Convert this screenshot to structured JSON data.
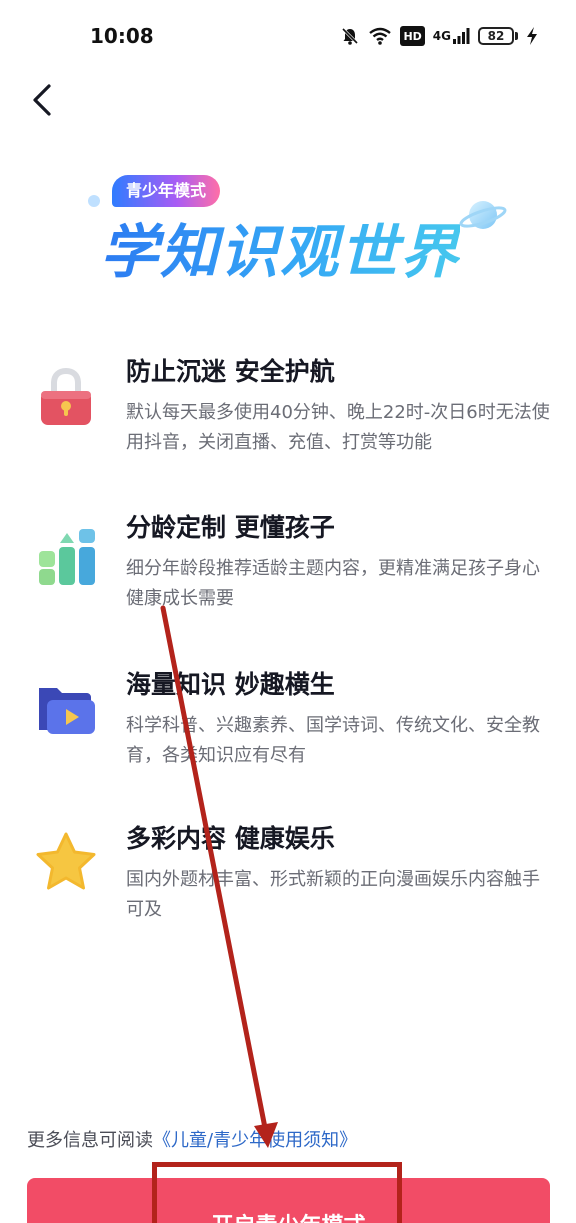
{
  "status_bar": {
    "time": "10:08",
    "hd_label": "HD",
    "network_label": "4G",
    "battery_level": "82"
  },
  "header": {
    "back_icon": "chevron-left-icon"
  },
  "hero": {
    "badge": "青少年模式",
    "title": "学知识观世界"
  },
  "features": [
    {
      "icon": "lock-icon",
      "title": "防止沉迷 安全护航",
      "description": "默认每天最多使用40分钟、晚上22时-次日6时无法使用抖音，关闭直播、充值、打赏等功能"
    },
    {
      "icon": "bar-chart-icon",
      "title": "分龄定制 更懂孩子",
      "description": "细分年龄段推荐适龄主题内容，更精准满足孩子身心健康成长需要"
    },
    {
      "icon": "video-folder-icon",
      "title": "海量知识 妙趣横生",
      "description": "科学科普、兴趣素养、国学诗词、传统文化、安全教育，各类知识应有尽有"
    },
    {
      "icon": "star-icon",
      "title": "多彩内容 健康娱乐",
      "description": "国内外题材丰富、形式新颖的正向漫画娱乐内容触手可及"
    }
  ],
  "footer": {
    "info_prefix": "更多信息可阅读",
    "info_link": "《儿童/青少年使用须知》",
    "primary_button": "开启青少年模式"
  },
  "colors": {
    "accent": "#f24c66",
    "link": "#2e69c8",
    "annotation": "#b3231b"
  }
}
